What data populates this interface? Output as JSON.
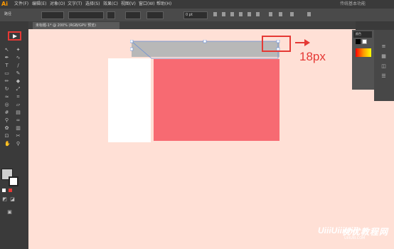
{
  "app": {
    "logo": "Ai"
  },
  "menus": [
    "文件(F)",
    "编辑(E)",
    "对象(O)",
    "文字(T)",
    "选择(S)",
    "效果(C)",
    "视图(V)",
    "窗口(W)",
    "帮助(H)"
  ],
  "workspace": {
    "label": "传统基本功能"
  },
  "control_bar": {
    "label": "路径",
    "stroke_weight": "0 pt"
  },
  "document_tab": {
    "title": "未标题-1* @ 200% (RGB/GPU 预览)"
  },
  "panel": {
    "title": "颜色"
  },
  "annotation": {
    "text": "18px"
  },
  "watermark": {
    "brand": "优优教程网",
    "mark": "UiiiUiiiUiii",
    "url": "UIIIUIII.COM"
  },
  "colors": {
    "highlight": "#e53935",
    "red_rect": "#f76a72",
    "gray_rect": "#b8b8b8",
    "canvas": "#ffe0d6"
  },
  "icons": [
    "selection-tool-icon",
    "direct-selection-icon",
    "pen-icon",
    "type-icon",
    "line-icon",
    "rectangle-icon",
    "brush-icon",
    "pencil-icon",
    "eraser-icon",
    "rotate-icon",
    "scale-icon",
    "warp-icon",
    "shape-builder-icon",
    "eyedropper-icon",
    "blend-icon",
    "symbol-icon",
    "graph-icon",
    "artboard-icon",
    "slice-icon",
    "hand-icon",
    "zoom-icon"
  ]
}
